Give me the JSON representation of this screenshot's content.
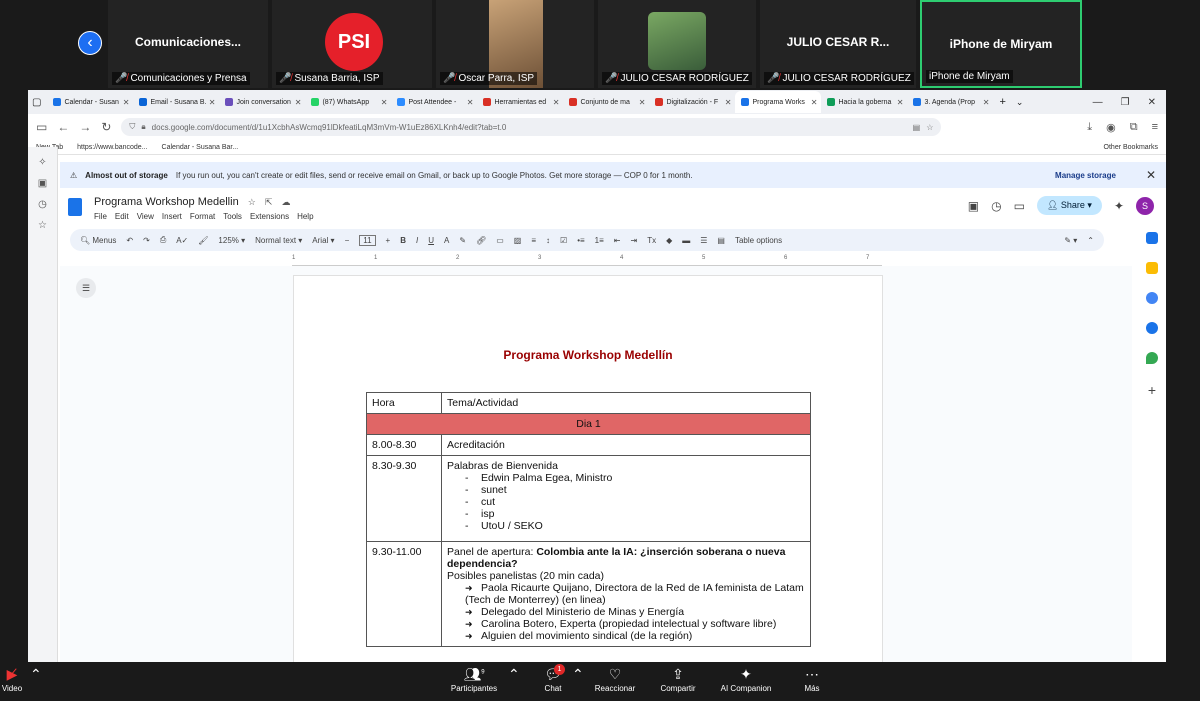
{
  "zoom": {
    "participants": [
      {
        "tile_text": "Comunicaciones...",
        "label": "Comunicaciones y Prensa",
        "muted": true
      },
      {
        "tile_text": "PSI",
        "label": "Susana Barria, ISP",
        "muted": true
      },
      {
        "tile_text": "",
        "label": "Oscar Parra, ISP",
        "muted": true
      },
      {
        "tile_text": "",
        "label": "JULIO CESAR RODRÍGUEZ",
        "muted": true
      },
      {
        "tile_text": "JULIO CESAR R...",
        "label": "JULIO CESAR RODRÍGUEZ",
        "muted": true
      },
      {
        "tile_text": "iPhone de Miryam",
        "label": "iPhone de Miryam",
        "muted": false
      }
    ],
    "bottom_bar": {
      "video": "Video",
      "participants": "Participantes",
      "participants_count": "9",
      "chat": "Chat",
      "chat_badge": "1",
      "reactions": "Reaccionar",
      "share": "Compartir",
      "ai": "AI Companion",
      "more": "Más"
    }
  },
  "browser": {
    "tabs": [
      {
        "label": "Calendar - Susan",
        "color": "#1a73e8"
      },
      {
        "label": "Email - Susana B.",
        "color": "#0a64d6"
      },
      {
        "label": "Join conversation",
        "color": "#6b4fbb"
      },
      {
        "label": "(87) WhatsApp",
        "color": "#25d366"
      },
      {
        "label": "Post Attendee -",
        "color": "#2d8cff"
      },
      {
        "label": "Herramientas ed",
        "color": "#d93025"
      },
      {
        "label": "Conjunto de ma",
        "color": "#d93025"
      },
      {
        "label": "Digitalización - F",
        "color": "#d93025"
      },
      {
        "label": "Programa Works",
        "color": "#1a73e8",
        "active": true
      },
      {
        "label": "Hacia la goberna",
        "color": "#0f9d58"
      },
      {
        "label": "3. Agenda (Prop",
        "color": "#1a73e8"
      }
    ],
    "url": "docs.google.com/document/d/1u1XcbhAsWcmq91lDkfeatiLqM3mVm-W1uEz86XLKnh4/edit?tab=t.0",
    "bookmarks": [
      "New Tab",
      "https://www.bancode...",
      "Calendar - Susana Bar...",
      "Other Bookmarks"
    ]
  },
  "storage_banner": {
    "title": "Almost out of storage",
    "message": "If you run out, you can't create or edit files, send or receive email on Gmail, or back up to Google Photos. Get more storage — COP 0 for 1 month.",
    "action": "Manage storage"
  },
  "docs": {
    "title": "Programa Workshop Medellin",
    "menu": [
      "File",
      "Edit",
      "View",
      "Insert",
      "Format",
      "Tools",
      "Extensions",
      "Help"
    ],
    "share": "Share",
    "avatar": "S",
    "toolbar": {
      "menus": "Menus",
      "zoom": "125%",
      "style": "Normal text",
      "font": "Arial",
      "size": "11",
      "table_options": "Table options"
    },
    "ruler_marks": [
      "1",
      "1",
      "2",
      "3",
      "4",
      "5",
      "6",
      "7"
    ]
  },
  "document": {
    "heading": "Programa Workshop Medellín",
    "col_hora": "Hora",
    "col_tema": "Tema/Actividad",
    "day1": "Dia 1",
    "rows": [
      {
        "hora": "8.00-8.30",
        "tema": "Acreditación"
      },
      {
        "hora": "8.30-9.30",
        "tema": "Palabras de Bienvenida",
        "items": [
          "Edwin Palma Egea, Ministro",
          "sunet",
          "cut",
          "isp",
          "UtoU / SEKO"
        ]
      },
      {
        "hora": "9.30-11.00",
        "tema_prefix": "Panel de apertura: ",
        "tema_bold": "Colombia ante la IA: ¿inserción soberana o nueva dependencia?",
        "subtitle": "Posibles panelistas (20 min cada)",
        "arrow_items": [
          "Paola Ricaurte Quijano, Directora de la Red de IA feminista de Latam (Tech de Monterrey) (en linea)",
          "Delegado del Ministerio de Minas y Energía",
          "Carolina Botero, Experta (propiedad intelectual y software libre)",
          "Alguien del movimiento sindical (de la región)"
        ]
      }
    ]
  }
}
